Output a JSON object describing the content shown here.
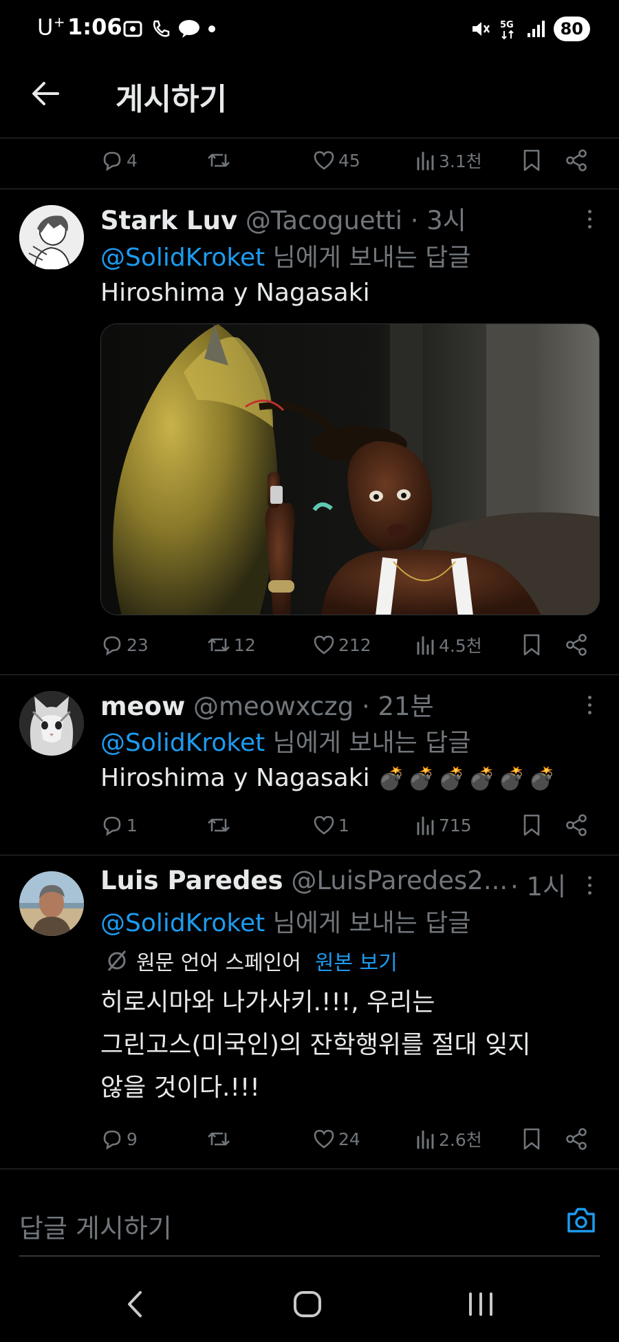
{
  "status_bar": {
    "carrier": "U",
    "carrier_sup": "+",
    "time": "1:06",
    "network": "5G",
    "battery": "80"
  },
  "header": {
    "title": "게시하기"
  },
  "top_actions": {
    "replies": "4",
    "reposts": "",
    "likes": "45",
    "views": "3.1천"
  },
  "tweets": [
    {
      "name": "Stark Luv",
      "handle": "@Tacoguetti",
      "time": "· 3시",
      "reply_mention": "@SolidKroket",
      "reply_suffix": " 님에게 보내는 답글",
      "text": "Hiroshima y Nagasaki",
      "actions": {
        "replies": "23",
        "reposts": "12",
        "likes": "212",
        "views": "4.5천"
      }
    },
    {
      "name": "meow",
      "handle": "@meowxczg",
      "time": "· 21분",
      "reply_mention": "@SolidKroket",
      "reply_suffix": " 님에게 보내는 답글",
      "text": "Hiroshima y Nagasaki",
      "emoji": "💣💣💣💣💣💣",
      "actions": {
        "replies": "1",
        "reposts": "",
        "likes": "1",
        "views": "715"
      }
    },
    {
      "name": "Luis Paredes",
      "handle": "@LuisParedes2...",
      "time": "· 1시",
      "reply_mention": "@SolidKroket",
      "reply_suffix": " 님에게 보내는 답글",
      "translation_note": "원문 언어 스페인어",
      "translation_link": "원본 보기",
      "text_lines": [
        "히로시마와 나가사키.!!!, 우리는",
        "그린고스(미국인)의 잔학행위를 절대 잊지",
        "않을 것이다.!!!"
      ],
      "actions": {
        "replies": "9",
        "reposts": "",
        "likes": "24",
        "views": "2.6천"
      }
    }
  ],
  "compose": {
    "placeholder": "답글 게시하기"
  },
  "colors": {
    "background": "#000000",
    "text": "#e7e9ea",
    "muted": "#71767b",
    "accent": "#1d9bf0",
    "divider": "#2f3336"
  }
}
